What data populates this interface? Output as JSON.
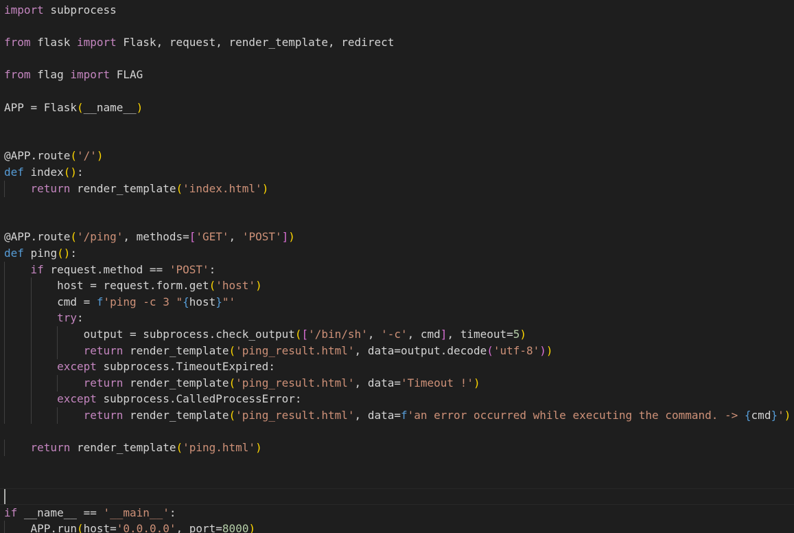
{
  "colors": {
    "background": "#1e1e1e",
    "keyword": "#569cd6",
    "control": "#c586c0",
    "function": "#dcdcaa",
    "class": "#4ec9b0",
    "variable": "#9cdcfe",
    "string": "#ce9178",
    "number": "#b5cea8",
    "text": "#d4d4d4",
    "bracket_yellow": "#ffd700",
    "bracket_purple": "#da70d6",
    "bracket_blue": "#179fff",
    "indent_guide": "#404040"
  },
  "cursor_line": 30,
  "lines": [
    {
      "indent": 0,
      "tokens": [
        {
          "t": "import",
          "c": "control"
        },
        {
          "t": " subprocess",
          "c": "text"
        }
      ]
    },
    {
      "indent": 0,
      "tokens": []
    },
    {
      "indent": 0,
      "tokens": [
        {
          "t": "from",
          "c": "control"
        },
        {
          "t": " flask ",
          "c": "text"
        },
        {
          "t": "import",
          "c": "control"
        },
        {
          "t": " Flask, request, render_template, redirect",
          "c": "text"
        }
      ]
    },
    {
      "indent": 0,
      "tokens": []
    },
    {
      "indent": 0,
      "tokens": [
        {
          "t": "from",
          "c": "control"
        },
        {
          "t": " flag ",
          "c": "text"
        },
        {
          "t": "import",
          "c": "control"
        },
        {
          "t": " FLAG",
          "c": "text"
        }
      ]
    },
    {
      "indent": 0,
      "tokens": []
    },
    {
      "indent": 0,
      "tokens": [
        {
          "t": "APP = Flask",
          "c": "text"
        },
        {
          "t": "(",
          "c": "bracket_yellow"
        },
        {
          "t": "__name__",
          "c": "text"
        },
        {
          "t": ")",
          "c": "bracket_yellow"
        }
      ]
    },
    {
      "indent": 0,
      "tokens": []
    },
    {
      "indent": 0,
      "tokens": []
    },
    {
      "indent": 0,
      "tokens": [
        {
          "t": "@APP.route",
          "c": "text"
        },
        {
          "t": "(",
          "c": "bracket_yellow"
        },
        {
          "t": "'/'",
          "c": "string"
        },
        {
          "t": ")",
          "c": "bracket_yellow"
        }
      ]
    },
    {
      "indent": 0,
      "tokens": [
        {
          "t": "def",
          "c": "keyword"
        },
        {
          "t": " index",
          "c": "text"
        },
        {
          "t": "()",
          "c": "bracket_yellow"
        },
        {
          "t": ":",
          "c": "text"
        }
      ]
    },
    {
      "indent": 1,
      "tokens": [
        {
          "t": "return",
          "c": "control"
        },
        {
          "t": " render_template",
          "c": "text"
        },
        {
          "t": "(",
          "c": "bracket_yellow"
        },
        {
          "t": "'index.html'",
          "c": "string"
        },
        {
          "t": ")",
          "c": "bracket_yellow"
        }
      ]
    },
    {
      "indent": 0,
      "tokens": []
    },
    {
      "indent": 0,
      "tokens": []
    },
    {
      "indent": 0,
      "tokens": [
        {
          "t": "@APP.route",
          "c": "text"
        },
        {
          "t": "(",
          "c": "bracket_yellow"
        },
        {
          "t": "'/ping'",
          "c": "string"
        },
        {
          "t": ", methods=",
          "c": "text"
        },
        {
          "t": "[",
          "c": "bracket_purple"
        },
        {
          "t": "'GET'",
          "c": "string"
        },
        {
          "t": ", ",
          "c": "text"
        },
        {
          "t": "'POST'",
          "c": "string"
        },
        {
          "t": "]",
          "c": "bracket_purple"
        },
        {
          "t": ")",
          "c": "bracket_yellow"
        }
      ]
    },
    {
      "indent": 0,
      "tokens": [
        {
          "t": "def",
          "c": "keyword"
        },
        {
          "t": " ping",
          "c": "text"
        },
        {
          "t": "()",
          "c": "bracket_yellow"
        },
        {
          "t": ":",
          "c": "text"
        }
      ]
    },
    {
      "indent": 1,
      "tokens": [
        {
          "t": "if",
          "c": "control"
        },
        {
          "t": " request.method == ",
          "c": "text"
        },
        {
          "t": "'POST'",
          "c": "string"
        },
        {
          "t": ":",
          "c": "text"
        }
      ]
    },
    {
      "indent": 2,
      "tokens": [
        {
          "t": "host = request.form.get",
          "c": "text"
        },
        {
          "t": "(",
          "c": "bracket_yellow"
        },
        {
          "t": "'host'",
          "c": "string"
        },
        {
          "t": ")",
          "c": "bracket_yellow"
        }
      ]
    },
    {
      "indent": 2,
      "tokens": [
        {
          "t": "cmd = ",
          "c": "text"
        },
        {
          "t": "f",
          "c": "keyword"
        },
        {
          "t": "'ping -c 3 \"",
          "c": "string"
        },
        {
          "t": "{",
          "c": "keyword"
        },
        {
          "t": "host",
          "c": "text"
        },
        {
          "t": "}",
          "c": "keyword"
        },
        {
          "t": "\"'",
          "c": "string"
        }
      ]
    },
    {
      "indent": 2,
      "tokens": [
        {
          "t": "try",
          "c": "control"
        },
        {
          "t": ":",
          "c": "text"
        }
      ]
    },
    {
      "indent": 3,
      "tokens": [
        {
          "t": "output = subprocess.check_output",
          "c": "text"
        },
        {
          "t": "(",
          "c": "bracket_yellow"
        },
        {
          "t": "[",
          "c": "bracket_purple"
        },
        {
          "t": "'/bin/sh'",
          "c": "string"
        },
        {
          "t": ", ",
          "c": "text"
        },
        {
          "t": "'-c'",
          "c": "string"
        },
        {
          "t": ", cmd",
          "c": "text"
        },
        {
          "t": "]",
          "c": "bracket_purple"
        },
        {
          "t": ", timeout=",
          "c": "text"
        },
        {
          "t": "5",
          "c": "number"
        },
        {
          "t": ")",
          "c": "bracket_yellow"
        }
      ]
    },
    {
      "indent": 3,
      "tokens": [
        {
          "t": "return",
          "c": "control"
        },
        {
          "t": " render_template",
          "c": "text"
        },
        {
          "t": "(",
          "c": "bracket_yellow"
        },
        {
          "t": "'ping_result.html'",
          "c": "string"
        },
        {
          "t": ", data=output.decode",
          "c": "text"
        },
        {
          "t": "(",
          "c": "bracket_purple"
        },
        {
          "t": "'utf-8'",
          "c": "string"
        },
        {
          "t": ")",
          "c": "bracket_purple"
        },
        {
          "t": ")",
          "c": "bracket_yellow"
        }
      ]
    },
    {
      "indent": 2,
      "tokens": [
        {
          "t": "except",
          "c": "control"
        },
        {
          "t": " subprocess.TimeoutExpired:",
          "c": "text"
        }
      ]
    },
    {
      "indent": 3,
      "tokens": [
        {
          "t": "return",
          "c": "control"
        },
        {
          "t": " render_template",
          "c": "text"
        },
        {
          "t": "(",
          "c": "bracket_yellow"
        },
        {
          "t": "'ping_result.html'",
          "c": "string"
        },
        {
          "t": ", data=",
          "c": "text"
        },
        {
          "t": "'Timeout !'",
          "c": "string"
        },
        {
          "t": ")",
          "c": "bracket_yellow"
        }
      ]
    },
    {
      "indent": 2,
      "tokens": [
        {
          "t": "except",
          "c": "control"
        },
        {
          "t": " subprocess.CalledProcessError:",
          "c": "text"
        }
      ]
    },
    {
      "indent": 3,
      "tokens": [
        {
          "t": "return",
          "c": "control"
        },
        {
          "t": " render_template",
          "c": "text"
        },
        {
          "t": "(",
          "c": "bracket_yellow"
        },
        {
          "t": "'ping_result.html'",
          "c": "string"
        },
        {
          "t": ", data=",
          "c": "text"
        },
        {
          "t": "f",
          "c": "keyword"
        },
        {
          "t": "'an error occurred while executing the command. -> ",
          "c": "string"
        },
        {
          "t": "{",
          "c": "keyword"
        },
        {
          "t": "cmd",
          "c": "text"
        },
        {
          "t": "}",
          "c": "keyword"
        },
        {
          "t": "'",
          "c": "string"
        },
        {
          "t": ")",
          "c": "bracket_yellow"
        }
      ]
    },
    {
      "indent": 0,
      "tokens": []
    },
    {
      "indent": 1,
      "tokens": [
        {
          "t": "return",
          "c": "control"
        },
        {
          "t": " render_template",
          "c": "text"
        },
        {
          "t": "(",
          "c": "bracket_yellow"
        },
        {
          "t": "'ping.html'",
          "c": "string"
        },
        {
          "t": ")",
          "c": "bracket_yellow"
        }
      ]
    },
    {
      "indent": 0,
      "tokens": []
    },
    {
      "indent": 0,
      "tokens": []
    },
    {
      "indent": 0,
      "tokens": []
    },
    {
      "indent": 0,
      "tokens": [
        {
          "t": "if",
          "c": "control"
        },
        {
          "t": " __name__ == ",
          "c": "text"
        },
        {
          "t": "'__main__'",
          "c": "string"
        },
        {
          "t": ":",
          "c": "text"
        }
      ]
    },
    {
      "indent": 1,
      "tokens": [
        {
          "t": "APP.run",
          "c": "text"
        },
        {
          "t": "(",
          "c": "bracket_yellow"
        },
        {
          "t": "host=",
          "c": "text"
        },
        {
          "t": "'0.0.0.0'",
          "c": "string"
        },
        {
          "t": ", port=",
          "c": "text"
        },
        {
          "t": "8000",
          "c": "number"
        },
        {
          "t": ")",
          "c": "bracket_yellow"
        }
      ]
    }
  ]
}
